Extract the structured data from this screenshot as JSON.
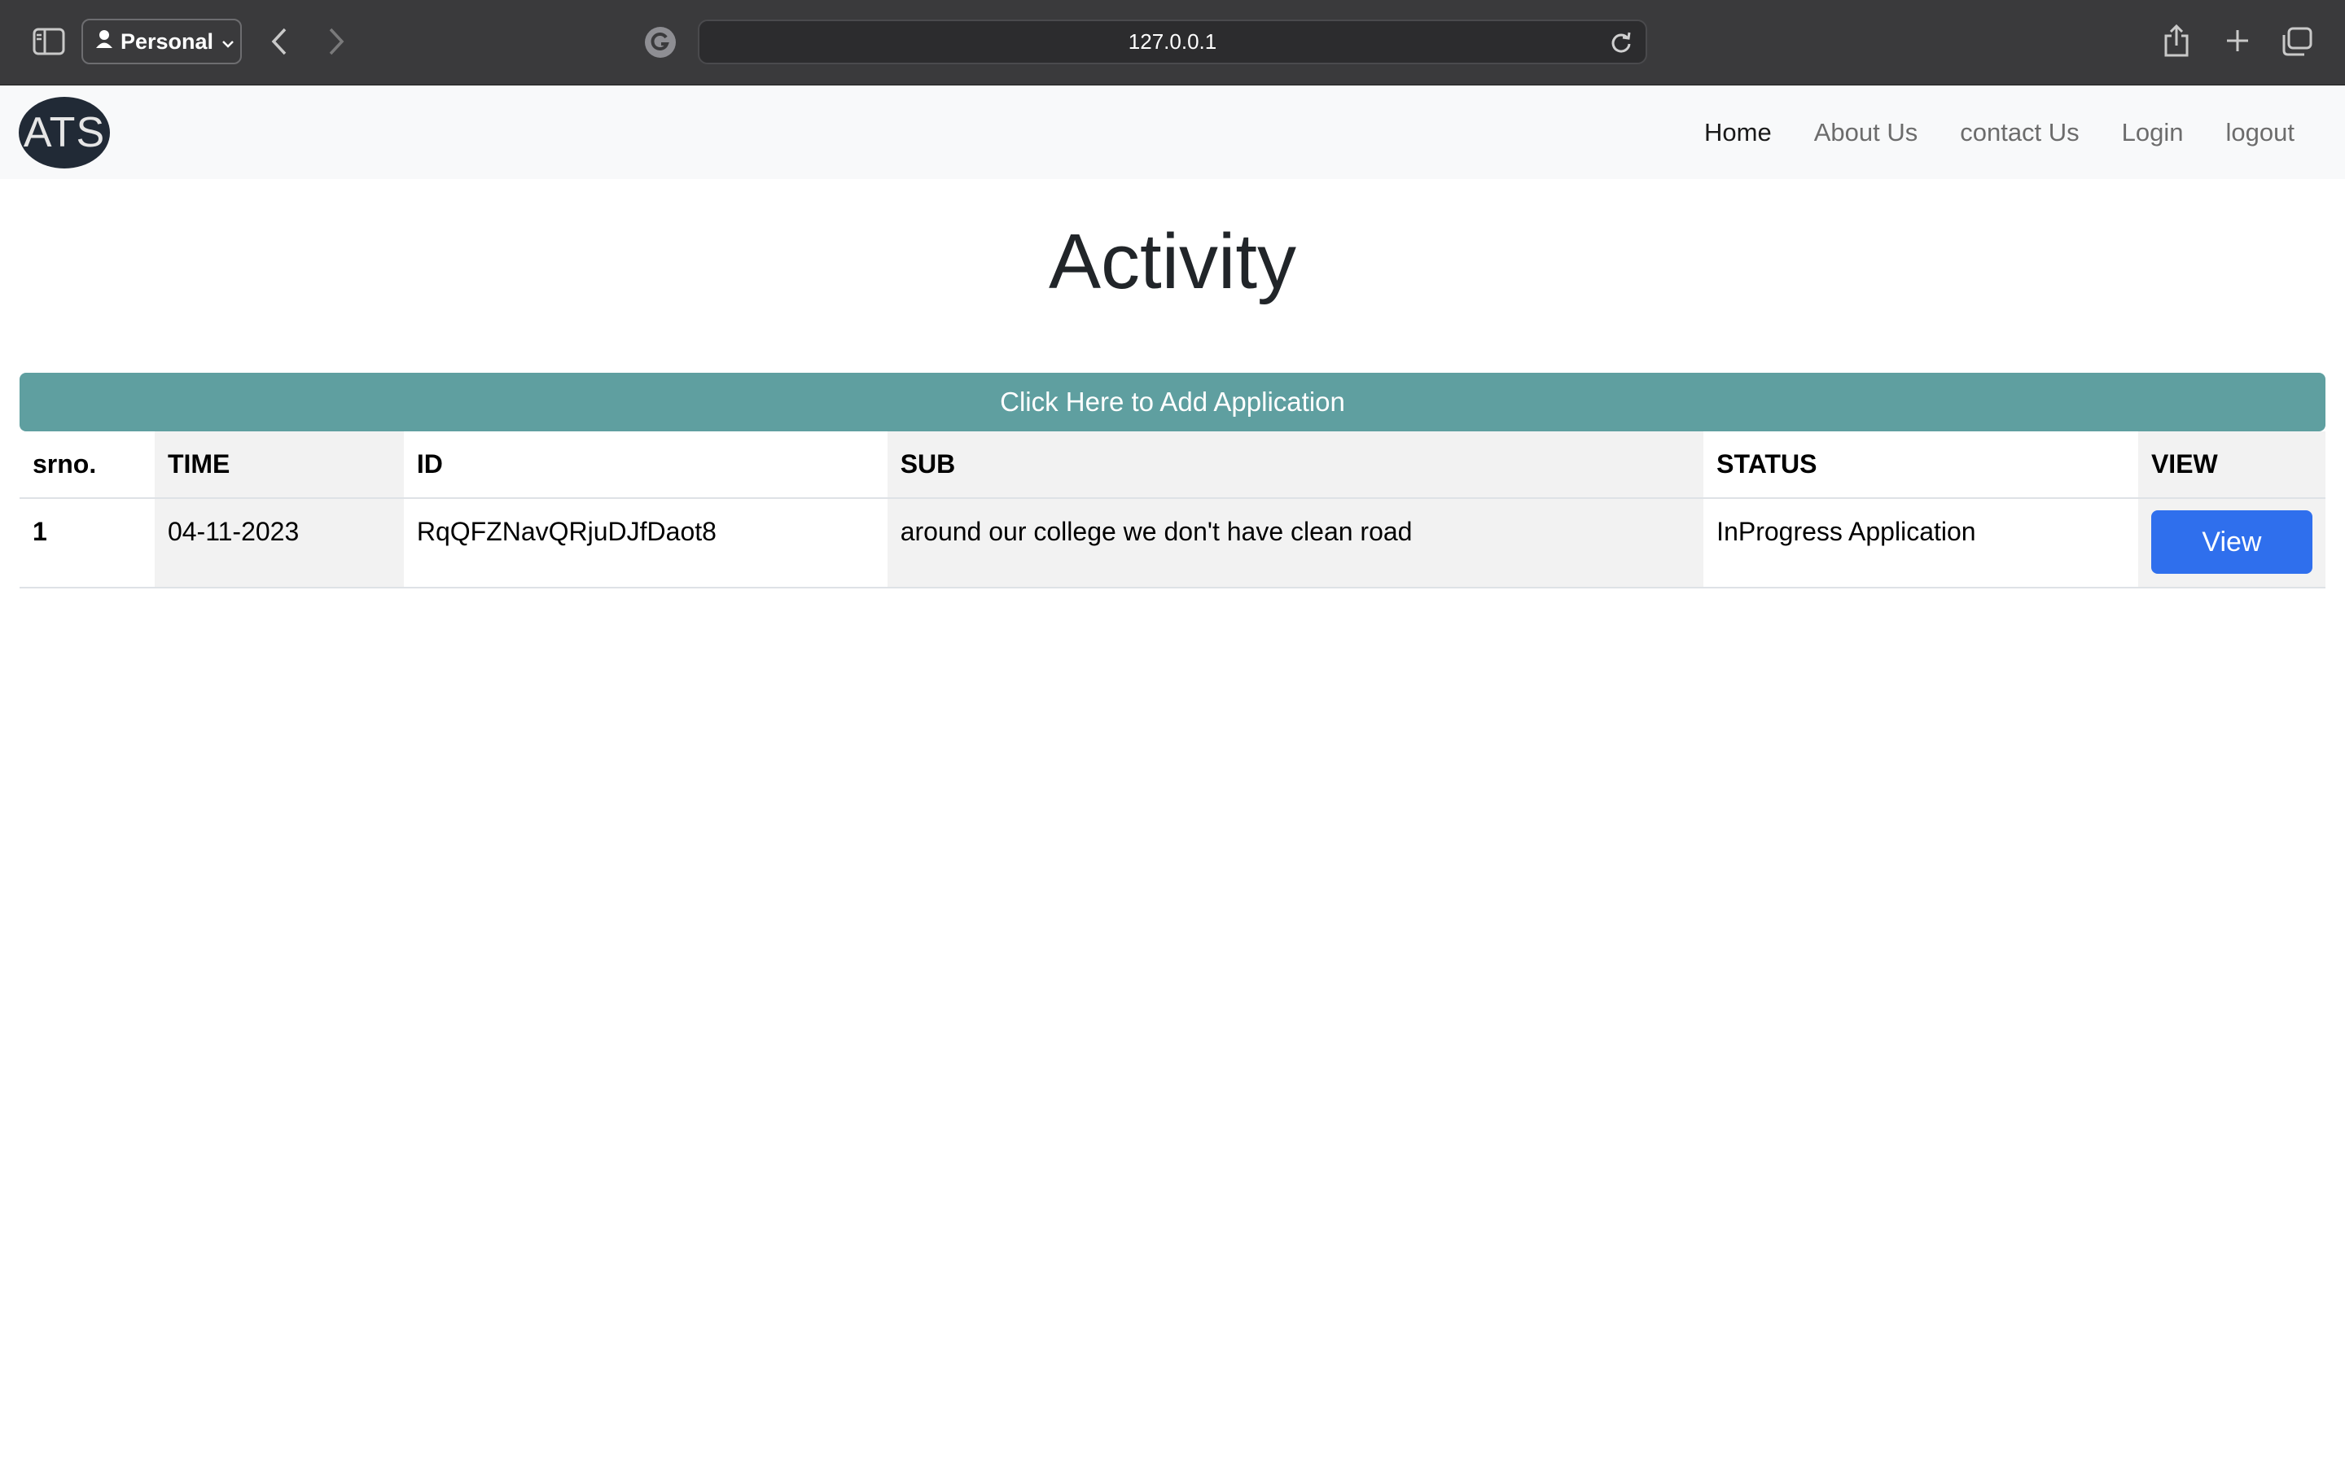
{
  "browser": {
    "profile_label": "Personal",
    "url": "127.0.0.1"
  },
  "navbar": {
    "logo": "ATS",
    "links": [
      {
        "label": "Home",
        "active": true
      },
      {
        "label": "About Us"
      },
      {
        "label": "contact Us"
      },
      {
        "label": "Login"
      },
      {
        "label": "logout"
      }
    ]
  },
  "main": {
    "title": "Activity",
    "add_button": "Click Here to Add Application",
    "table": {
      "headers": [
        "srno.",
        "TIME",
        "ID",
        "SUB",
        "STATUS",
        "VIEW"
      ],
      "rows": [
        {
          "srno": "1",
          "time": "04-11-2023",
          "id": "RqQFZNavQRjuDJfDaot8",
          "sub": "around our college we don't have clean road",
          "status": "InProgress Application",
          "view": "View"
        }
      ]
    }
  },
  "colors": {
    "chrome_bg": "#3a3a3c",
    "navbar_bg": "#f8f9fa",
    "add_button_bg": "#5f9fa0",
    "view_button_bg": "#2f6fed",
    "shaded_column_bg": "#f2f2f2"
  }
}
